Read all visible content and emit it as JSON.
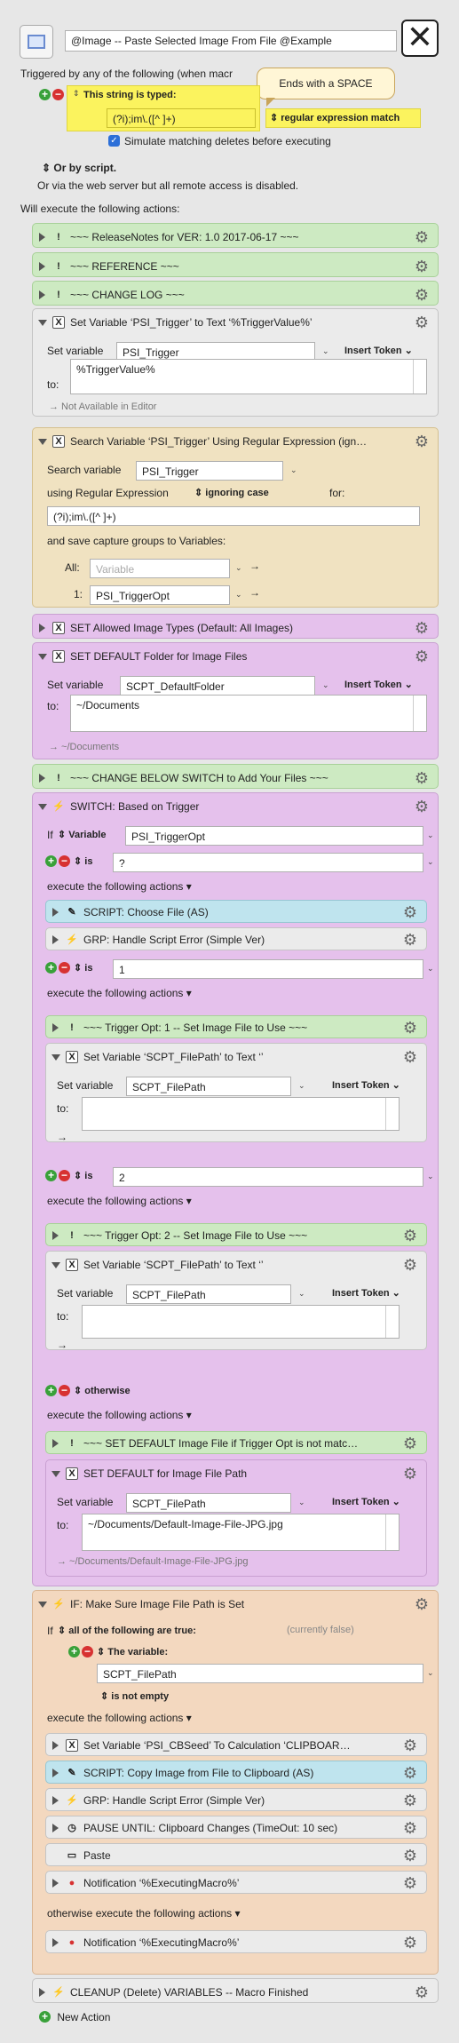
{
  "macro": {
    "name": "@Image -- Paste Selected Image From File @Example",
    "close_icon": "close-x-icon"
  },
  "trigger": {
    "header": "Triggered by any of the following (when macr",
    "typed_label": "This string is typed:",
    "typed_value": "(?i);im\\.([^ ]+)",
    "regex_option": "regular expression match",
    "simulate_label": "Simulate matching deletes before executing",
    "tooltip": "Ends with a SPACE",
    "or_script": "Or by script.",
    "or_web": "Or via the web server but all remote access is disabled."
  },
  "will_execute": "Will execute the following actions:",
  "actions": {
    "release": "~~~ ReleaseNotes for  VER: 1.0    2017-06-17 ~~~",
    "reference": "~~~ REFERENCE ~~~",
    "changelog": "~~~ CHANGE LOG ~~~",
    "setvar1": {
      "title": "Set Variable ‘PSI_Trigger’ to Text ‘%TriggerValue%’",
      "set_label": "Set variable",
      "var": "PSI_Trigger",
      "insert": "Insert Token",
      "to_label": "to:",
      "value": "%TriggerValue%",
      "note": "→ Not Available in Editor"
    },
    "search": {
      "title": "Search Variable ‘PSI_Trigger’ Using Regular Expression (ign…",
      "search_label": "Search variable",
      "var": "PSI_Trigger",
      "using_label": "using Regular Expression",
      "case": "ignoring case",
      "for_label": "for:",
      "regex": "(?i);im\\.([^ ]+)",
      "save_label": "and save capture groups to Variables:",
      "all_label": "All:",
      "all_placeholder": "Variable",
      "one_label": "1:",
      "one_var": "PSI_TriggerOpt"
    },
    "allowed": "SET Allowed Image Types (Default:  All Images)",
    "folder": {
      "title": "SET DEFAULT Folder for Image Files",
      "set_label": "Set variable",
      "var": "SCPT_DefaultFolder",
      "insert": "Insert Token",
      "to_label": "to:",
      "value": "~/Documents",
      "note": "→ ~/Documents"
    },
    "change_below": "~~~ CHANGE BELOW SWITCH to Add Your Files ~~~",
    "switch": {
      "title": "SWITCH:  Based on Trigger",
      "if_label": "If",
      "var_type": "Variable",
      "var": "PSI_TriggerOpt",
      "is_label": "is",
      "exec_label": "execute the following actions",
      "case1": {
        "value": "?",
        "script": "SCRIPT:  Choose File (AS)",
        "grp": "GRP:  Handle Script Error (Simple Ver)"
      },
      "case2": {
        "value": "1",
        "comment": "~~~ Trigger Opt: 1 -- Set Image File to Use ~~~",
        "setvar": "Set Variable ‘SCPT_FilePath’ to Text ‘’",
        "set_label": "Set variable",
        "var": "SCPT_FilePath",
        "insert": "Insert Token",
        "to_label": "to:",
        "note": "→"
      },
      "case3": {
        "value": "2",
        "comment": "~~~ Trigger Opt: 2 -- Set Image File to Use ~~~",
        "setvar": "Set Variable ‘SCPT_FilePath’ to Text ‘’",
        "set_label": "Set variable",
        "var": "SCPT_FilePath",
        "insert": "Insert Token",
        "to_label": "to:",
        "note": "→"
      },
      "otherwise": {
        "label": "otherwise",
        "comment": "~~~ SET DEFAULT Image File if Trigger Opt is not matc…",
        "setdef": "SET DEFAULT for Image File Path",
        "set_label": "Set variable",
        "var": "SCPT_FilePath",
        "insert": "Insert Token",
        "to_label": "to:",
        "value": "~/Documents/Default-Image-File-JPG.jpg",
        "note": "→ ~/Documents/Default-Image-File-JPG.jpg"
      }
    },
    "ifblock": {
      "title": "IF:  Make Sure Image File Path is Set",
      "if_label": "If",
      "cond": "all of the following are true:",
      "state": "(currently false)",
      "the_var": "The variable:",
      "var": "SCPT_FilePath",
      "is_empty": "is not empty",
      "exec_label": "execute the following actions",
      "items": [
        "Set Variable ‘PSI_CBSeed’ To Calculation ‘CLIPBOAR…",
        "SCRIPT:  Copy Image from File to Clipboard (AS)",
        "GRP:  Handle Script Error (Simple Ver)",
        "PAUSE UNTIL:  Clipboard Changes (TimeOut: 10 sec)",
        "Paste",
        "Notification ‘%ExecutingMacro%’"
      ],
      "else_label": "otherwise execute the following actions",
      "else_item": "Notification ‘%ExecutingMacro%’"
    },
    "cleanup": "CLEANUP (Delete) VARIABLES -- Macro Finished"
  },
  "new_action": "New Action"
}
